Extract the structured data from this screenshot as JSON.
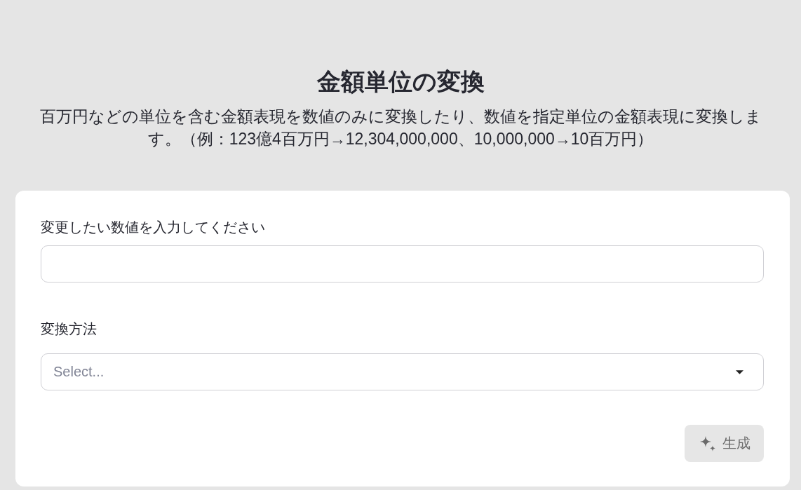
{
  "header": {
    "title": "金額単位の変換",
    "description": "百万円などの単位を含む金額表現を数値のみに変換したり、数値を指定単位の金額表現に変換します。（例：123億4百万円→12,304,000,000、10,000,000→10百万円）"
  },
  "form": {
    "fields": [
      {
        "kind": "text",
        "label": "変更したい数値を入力してください"
      },
      {
        "kind": "select",
        "label": "変換方法",
        "placeholder": "Select..."
      }
    ],
    "submit_button": {
      "label": "生成",
      "disabled": true
    }
  }
}
